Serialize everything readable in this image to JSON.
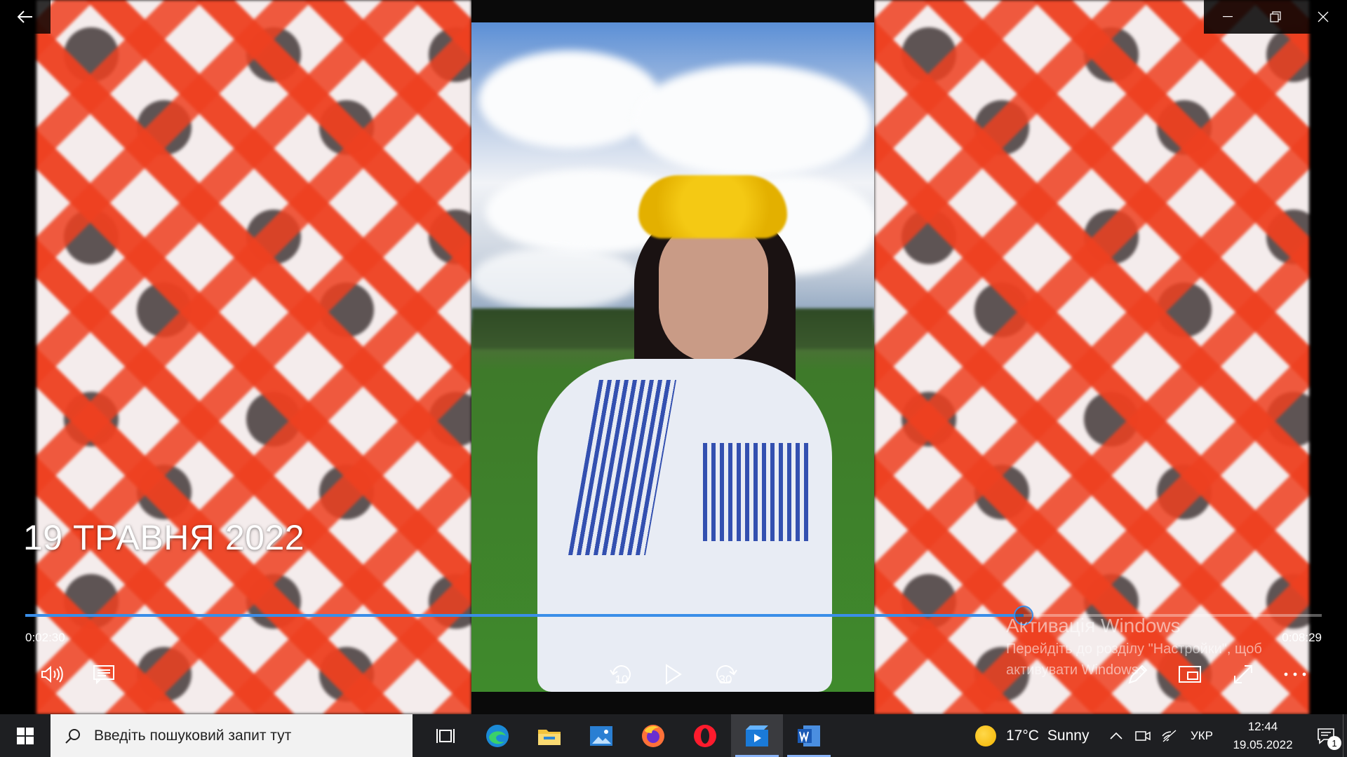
{
  "window": {
    "back_icon": "arrow-left-icon",
    "controls": [
      "minimize-icon",
      "restore-icon",
      "close-icon"
    ]
  },
  "video": {
    "title": "19 ТРАВНЯ 2022",
    "time_current": "0:02:30",
    "time_total": "0:08:29",
    "progress_fraction": 0.77,
    "accent_color": "#3a8ee8"
  },
  "controls": {
    "volume_icon": "volume-icon",
    "captions_icon": "captions-icon",
    "skip_back": "10",
    "skip_forward": "30",
    "play_icon": "play-icon",
    "edit_icon": "pen-icon",
    "mini_view_icon": "mini-view-icon",
    "fullscreen_icon": "fullscreen-icon",
    "more_icon": "more-icon"
  },
  "activation": {
    "title": "Активація Windows",
    "text": "Перейдіть до розділу \"Настройки\", щоб активувати Windows."
  },
  "taskbar": {
    "search_placeholder": "Введіть пошуковий запит тут",
    "apps": [
      "task-view-icon",
      "edge-icon",
      "file-explorer-icon",
      "photos-icon",
      "firefox-icon",
      "opera-icon",
      "movies-tv-icon",
      "word-icon"
    ],
    "weather_temp": "17°C",
    "weather_text": "Sunny",
    "language": "УКР",
    "time": "12:44",
    "date": "19.05.2022",
    "notification_count": "1"
  }
}
